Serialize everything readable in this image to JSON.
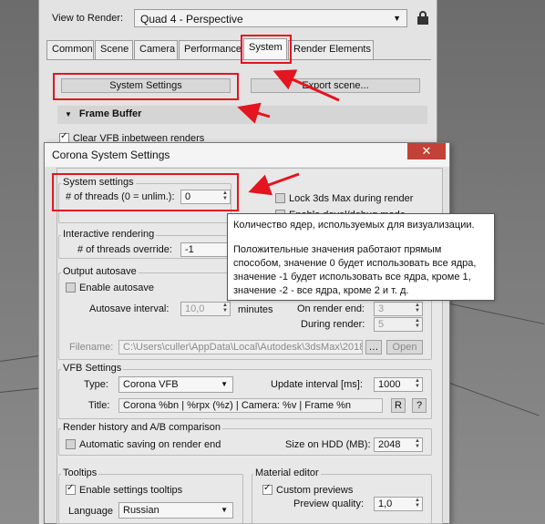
{
  "render_setup": {
    "view_to_render_label": "View to Render:",
    "view_to_render_value": "Quad 4 - Perspective",
    "tabs": [
      "Common",
      "Scene",
      "Camera",
      "Performance",
      "System",
      "Render Elements"
    ],
    "active_tab": "System",
    "system_settings_button": "System Settings",
    "export_scene_button": "Export scene...",
    "frame_buffer_rollout": "Frame Buffer",
    "clear_vfb_label": "Clear VFB inbetween renders"
  },
  "dialog": {
    "title": "Corona System Settings",
    "close_glyph": "✕",
    "system_settings": {
      "title": "System settings",
      "threads_label": "# of threads (0 = unlim.):",
      "threads_value": "0",
      "lock_label": "Lock 3ds Max during render",
      "devel_label": "Enable devel/debug mode"
    },
    "interactive": {
      "title": "Interactive rendering",
      "threads_override_label": "# of threads override:",
      "threads_override_value": "-1"
    },
    "output_autosave": {
      "title": "Output autosave",
      "enable_label": "Enable autosave",
      "interval_label": "Autosave interval:",
      "interval_value": "10,0",
      "interval_unit": "minutes",
      "on_render_end_label": "On render end:",
      "on_render_end_value": "3",
      "during_render_label": "During render:",
      "during_render_value": "5",
      "filename_label": "Filename:",
      "filename_value": "C:\\Users\\culler\\AppData\\Local\\Autodesk\\3dsMax\\2018",
      "open_button": "Open"
    },
    "vfb": {
      "title": "VFB Settings",
      "type_label": "Type:",
      "type_value": "Corona VFB",
      "update_label": "Update interval [ms]:",
      "update_value": "1000",
      "title_label": "Title:",
      "title_value": "Corona %bn | %rpx (%z) | Camera: %v | Frame %n",
      "r_button": "R",
      "help_button": "?"
    },
    "history": {
      "title": "Render history and A/B comparison",
      "auto_save_label": "Automatic saving on render end",
      "size_label": "Size on HDD (MB):",
      "size_value": "2048"
    },
    "tooltips": {
      "title": "Tooltips",
      "enable_label": "Enable settings tooltips",
      "language_label": "Language",
      "language_value": "Russian"
    },
    "material_editor": {
      "title": "Material editor",
      "custom_previews_label": "Custom previews",
      "preview_quality_label": "Preview quality:",
      "preview_quality_value": "1,0"
    }
  },
  "tooltip": {
    "line1": "Количество ядер, используемых для визуализации.",
    "line2": "Положительные значения работают прямым",
    "line3": "способом, значение 0 будет использовать все ядра,",
    "line4": "значение -1 будет использовать все ядра, кроме 1,",
    "line5": "значение -2 - все ядра, кроме 2 и т. д."
  },
  "colors": {
    "annotation_red": "#e3151f",
    "close_button": "#c44137"
  }
}
